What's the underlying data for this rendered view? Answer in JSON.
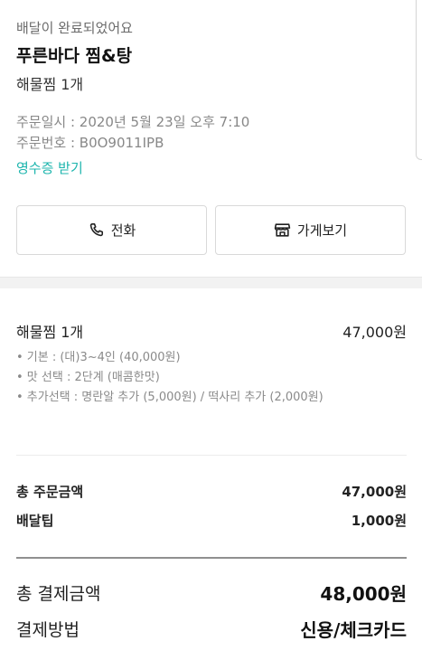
{
  "order": {
    "status": "배달이 완료되었어요",
    "store_name": "푸른바다 찜&탕",
    "summary": "해물찜 1개",
    "order_datetime": "주문일시 : 2020년 5월 23일 오후 7:10",
    "order_number": "주문번호 : B0O9011IPB",
    "receipt_link": "영수증 받기"
  },
  "actions": {
    "call_label": "전화",
    "store_label": "가게보기"
  },
  "items": [
    {
      "name": "해물찜 1개",
      "price": "47,000원",
      "options": [
        "• 기본 : (대)3~4인 (40,000원)",
        "• 맛 선택 : 2단계 (매콤한맛)",
        "• 추가선택 : 명란알 추가 (5,000원) / 떡사리 추가 (2,000원)"
      ]
    }
  ],
  "totals": {
    "order_total_label": "총 주문금액",
    "order_total_value": "47,000원",
    "delivery_tip_label": "배달팁",
    "delivery_tip_value": "1,000원"
  },
  "payment": {
    "total_label": "총 결제금액",
    "total_value": "48,000원",
    "method_label": "결제방법",
    "method_value": "신용/체크카드"
  },
  "colors": {
    "accent": "#1cb5ad",
    "muted_text": "#888888",
    "divider_bg": "#f2f2f2"
  },
  "icons": {
    "call": "phone-icon",
    "store": "store-icon"
  }
}
